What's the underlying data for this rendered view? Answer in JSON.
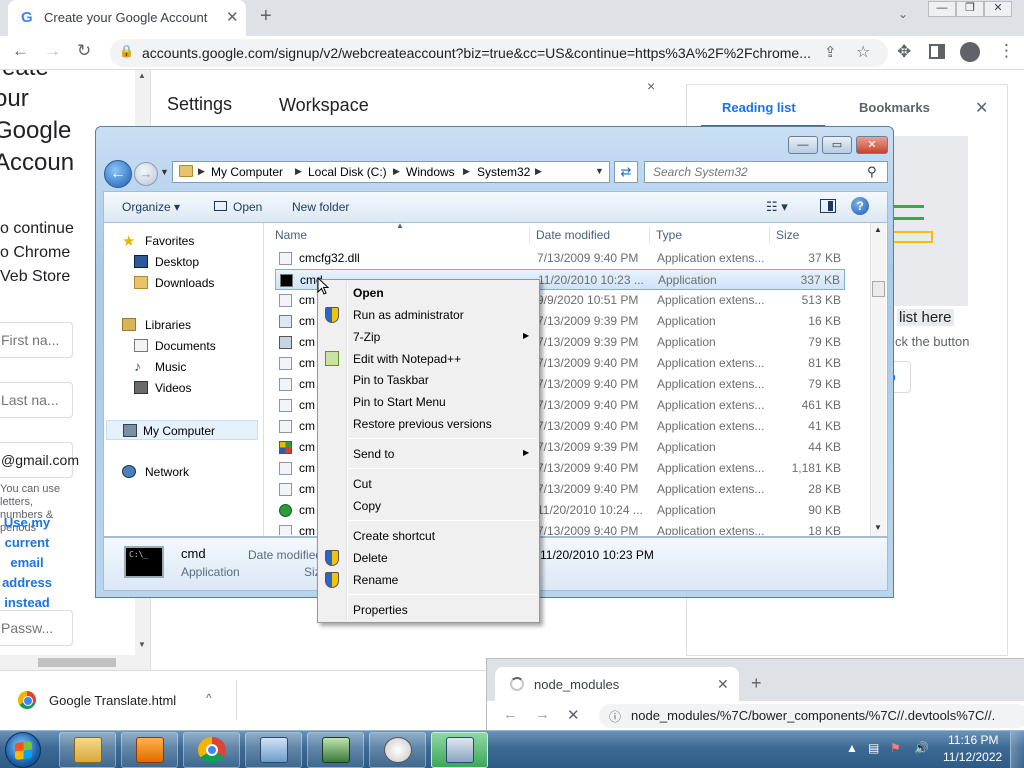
{
  "chrome": {
    "tab_title": "Create your Google Account",
    "tab_close": "✕",
    "new_tab": "+",
    "url": "accounts.google.com/signup/v2/webcreateaccount?biz=true&cc=US&continue=https%3A%2F%2Fchrome...",
    "win_min": "—",
    "win_max": "❐",
    "win_close": "✕"
  },
  "google_page": {
    "heading_lines": [
      "reate",
      "our",
      "Google",
      "Accoun"
    ],
    "subtitle_lines": [
      "o continue",
      "o Chrome",
      "Veb Store"
    ],
    "first_name_placeholder": "First na...",
    "last_name_placeholder": "Last na...",
    "email_value": "@gmail.com",
    "hint_text": "You can use letters, numbers & periods",
    "use_my_lines": [
      "Use my",
      "current",
      "email",
      "address",
      "instead"
    ],
    "password_placeholder": "Passw..."
  },
  "settings_panel": {
    "settings_title": "Settings",
    "workspace_title": "Workspace",
    "close": "×"
  },
  "side_panel": {
    "reading_list_tab": "Reading list",
    "bookmarks_tab": "Bookmarks",
    "close": "✕",
    "list_here": "list here",
    "click_button": "ck the button",
    "button_fragment": "b"
  },
  "downloads": {
    "file_name": "Google Translate.html",
    "caret": "^"
  },
  "chrome2": {
    "tab_title": "node_modules",
    "tab_close": "✕",
    "new_tab": "+",
    "url": "node_modules/%7C/bower_components/%7C//.devtools%7C//.",
    "stop": "✕"
  },
  "explorer": {
    "min": "—",
    "max": "▭",
    "close": "✕",
    "breadcrumb": [
      "My Computer",
      "Local Disk (C:)",
      "Windows",
      "System32"
    ],
    "search_placeholder": "Search System32",
    "toolbar": {
      "organize": "Organize ▾",
      "open": "Open",
      "new_folder": "New folder",
      "help": "?"
    },
    "nav": {
      "favorites": "Favorites",
      "desktop": "Desktop",
      "downloads": "Downloads",
      "libraries": "Libraries",
      "documents": "Documents",
      "music": "Music",
      "videos": "Videos",
      "my_computer": "My Computer",
      "network": "Network"
    },
    "columns": {
      "name": "Name",
      "date": "Date modified",
      "type": "Type",
      "size": "Size"
    },
    "rows": [
      {
        "name": "cmcfg32.dll",
        "date": "7/13/2009 9:40 PM",
        "type": "Application extens...",
        "size": "37 KB"
      },
      {
        "name": "cmd",
        "date": "11/20/2010 10:23 ...",
        "type": "Application",
        "size": "337 KB"
      },
      {
        "name": "cm",
        "date": "9/9/2020 10:51 PM",
        "type": "Application extens...",
        "size": "513 KB"
      },
      {
        "name": "cm",
        "date": "7/13/2009 9:39 PM",
        "type": "Application",
        "size": "16 KB"
      },
      {
        "name": "cm",
        "date": "7/13/2009 9:39 PM",
        "type": "Application",
        "size": "79 KB"
      },
      {
        "name": "cm",
        "date": "7/13/2009 9:40 PM",
        "type": "Application extens...",
        "size": "81 KB"
      },
      {
        "name": "cm",
        "date": "7/13/2009 9:40 PM",
        "type": "Application extens...",
        "size": "79 KB"
      },
      {
        "name": "cm",
        "date": "7/13/2009 9:40 PM",
        "type": "Application extens...",
        "size": "461 KB"
      },
      {
        "name": "cm",
        "date": "7/13/2009 9:40 PM",
        "type": "Application extens...",
        "size": "41 KB"
      },
      {
        "name": "cm",
        "date": "7/13/2009 9:39 PM",
        "type": "Application",
        "size": "44 KB"
      },
      {
        "name": "cm",
        "date": "7/13/2009 9:40 PM",
        "type": "Application extens...",
        "size": "1,181 KB"
      },
      {
        "name": "cm",
        "date": "7/13/2009 9:40 PM",
        "type": "Application extens...",
        "size": "28 KB"
      },
      {
        "name": "cm",
        "date": "11/20/2010 10:24 ...",
        "type": "Application",
        "size": "90 KB"
      },
      {
        "name": "cm",
        "date": "7/13/2009 9:40 PM",
        "type": "Application extens...",
        "size": "18 KB"
      }
    ],
    "details": {
      "name": "cmd",
      "type": "Application",
      "date_label": "Date modified",
      "size_label": "Siz",
      "date_value": "11/20/2010 10:23 PM"
    }
  },
  "context_menu": {
    "items": {
      "open": "Open",
      "run_admin": "Run as administrator",
      "seven_zip": "7-Zip",
      "edit_npp": "Edit with Notepad++",
      "pin_taskbar": "Pin to Taskbar",
      "pin_start": "Pin to Start Menu",
      "restore": "Restore previous versions",
      "send_to": "Send to",
      "cut": "Cut",
      "copy": "Copy",
      "create_shortcut": "Create shortcut",
      "delete": "Delete",
      "rename": "Rename",
      "properties": "Properties"
    },
    "submenu_arrow": "▶"
  },
  "taskbar": {
    "time": "11:16 PM",
    "date": "11/12/2022"
  },
  "colors": {
    "chrome_tabstrip": "#dee1e6",
    "google_blue": "#1a73e8",
    "explorer_frame": "#a9c9e8",
    "menu_bg": "#f0f0f0",
    "taskbar": "#3d6a94"
  }
}
